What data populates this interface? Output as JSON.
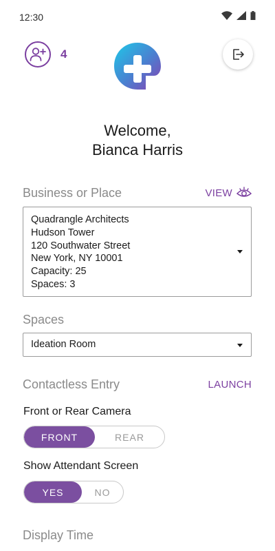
{
  "status_bar": {
    "time": "12:30"
  },
  "header": {
    "invite_count": "4",
    "icons": {
      "invite": "add-user-icon",
      "logo": "app-logo",
      "logout": "logout-icon"
    }
  },
  "welcome": {
    "line1": "Welcome,",
    "line2": "Bianca Harris"
  },
  "business": {
    "label": "Business or Place",
    "action": "VIEW",
    "action_icon": "eye-icon",
    "selected_lines": [
      "Quadrangle Architects",
      "Hudson Tower",
      "120 Southwater Street",
      "New York, NY  10001",
      "Capacity: 25",
      "Spaces: 3"
    ]
  },
  "spaces": {
    "label": "Spaces",
    "selected": "Ideation Room"
  },
  "contactless": {
    "label": "Contactless Entry",
    "action": "LAUNCH"
  },
  "camera": {
    "label": "Front or Rear Camera",
    "options": [
      "FRONT",
      "REAR"
    ],
    "selected": "FRONT"
  },
  "attendant": {
    "label": "Show Attendant Screen",
    "options": [
      "YES",
      "NO"
    ],
    "selected": "YES"
  },
  "display_time": {
    "label": "Display Time"
  },
  "colors": {
    "accent": "#7b3fa0",
    "logo_gradient_start": "#1ec8e8",
    "logo_gradient_end": "#8a3fb0"
  }
}
